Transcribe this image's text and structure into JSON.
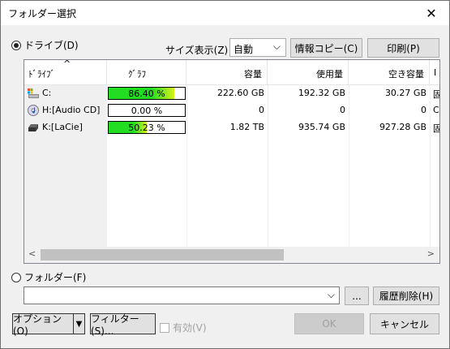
{
  "window": {
    "title": "フォルダー選択",
    "close_glyph": "✕"
  },
  "drive_radio": {
    "label": "ドライブ(D)",
    "selected": true
  },
  "size_display": {
    "label": "サイズ表示(Z)",
    "value": "自動"
  },
  "buttons": {
    "copy_info": "情報コピー(C)",
    "print": "印刷(P)"
  },
  "columns": [
    "ﾄﾞﾗｲﾌﾞ",
    "ｸﾞﾗﾌ",
    "容量",
    "使用量",
    "空き容量",
    "I"
  ],
  "drives": [
    {
      "name": "C:",
      "graph": "86.40 %",
      "usage_fraction": 0.864,
      "capacity": "222.60 GB",
      "used": "192.32 GB",
      "free": "30.27 GB",
      "extra": "固"
    },
    {
      "name": "H:[Audio CD]",
      "graph": "0.00 %",
      "usage_fraction": 0.0,
      "capacity": "0",
      "used": "0",
      "free": "0",
      "extra": "C"
    },
    {
      "name": "K:[LaCie]",
      "graph": "50.23 %",
      "usage_fraction": 0.5023,
      "capacity": "1.82 TB",
      "used": "935.74 GB",
      "free": "927.28 GB",
      "extra": "固"
    }
  ],
  "folder_radio": {
    "label": "フォルダー(F)",
    "selected": false
  },
  "folder_input": {
    "value": ""
  },
  "browse_button": "...",
  "history_delete": "履歴削除(H)",
  "options_button": "オプション(O)",
  "filter_button": "フィルター(S)...",
  "enabled_check": {
    "label": "有効(V)",
    "checked": false
  },
  "ok_button": "OK",
  "cancel_button": "キャンセル",
  "colors": {
    "bar_green": "#22dd22",
    "bar_yellow": "#d9f21a"
  }
}
